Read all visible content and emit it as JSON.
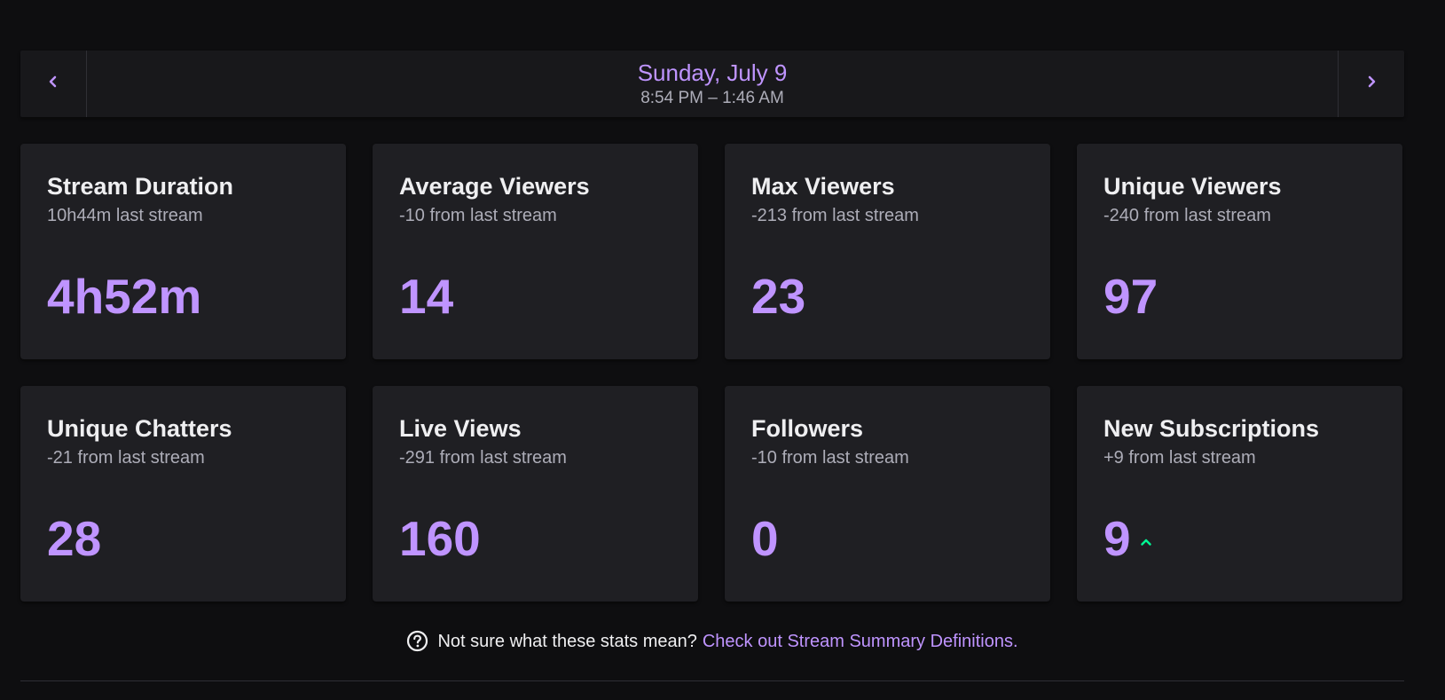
{
  "header": {
    "date": "Sunday, July 9",
    "time_range": "8:54 PM – 1:46 AM",
    "prev_icon": "chevron-left-icon",
    "next_icon": "chevron-right-icon"
  },
  "stats": [
    {
      "title": "Stream Duration",
      "subtitle": "10h44m last stream",
      "value": "4h52m"
    },
    {
      "title": "Average Viewers",
      "subtitle": "-10 from last stream",
      "value": "14"
    },
    {
      "title": "Max Viewers",
      "subtitle": "-213 from last stream",
      "value": "23"
    },
    {
      "title": "Unique Viewers",
      "subtitle": "-240 from last stream",
      "value": "97"
    },
    {
      "title": "Unique Chatters",
      "subtitle": "-21 from last stream",
      "value": "28"
    },
    {
      "title": "Live Views",
      "subtitle": "-291 from last stream",
      "value": "160"
    },
    {
      "title": "Followers",
      "subtitle": "-10 from last stream",
      "value": "0"
    },
    {
      "title": "New Subscriptions",
      "subtitle": "+9 from last stream",
      "value": "9",
      "trend": "up",
      "trend_icon": "chevron-up-icon"
    }
  ],
  "help": {
    "icon": "question-circle-icon",
    "text": "Not sure what these stats mean?",
    "link": "Check out Stream Summary Definitions."
  },
  "colors": {
    "background": "#0e0e10",
    "card": "#1f1f23",
    "accent": "#bf94ff",
    "trend_up": "#00f593",
    "muted_text": "#adadb8"
  }
}
